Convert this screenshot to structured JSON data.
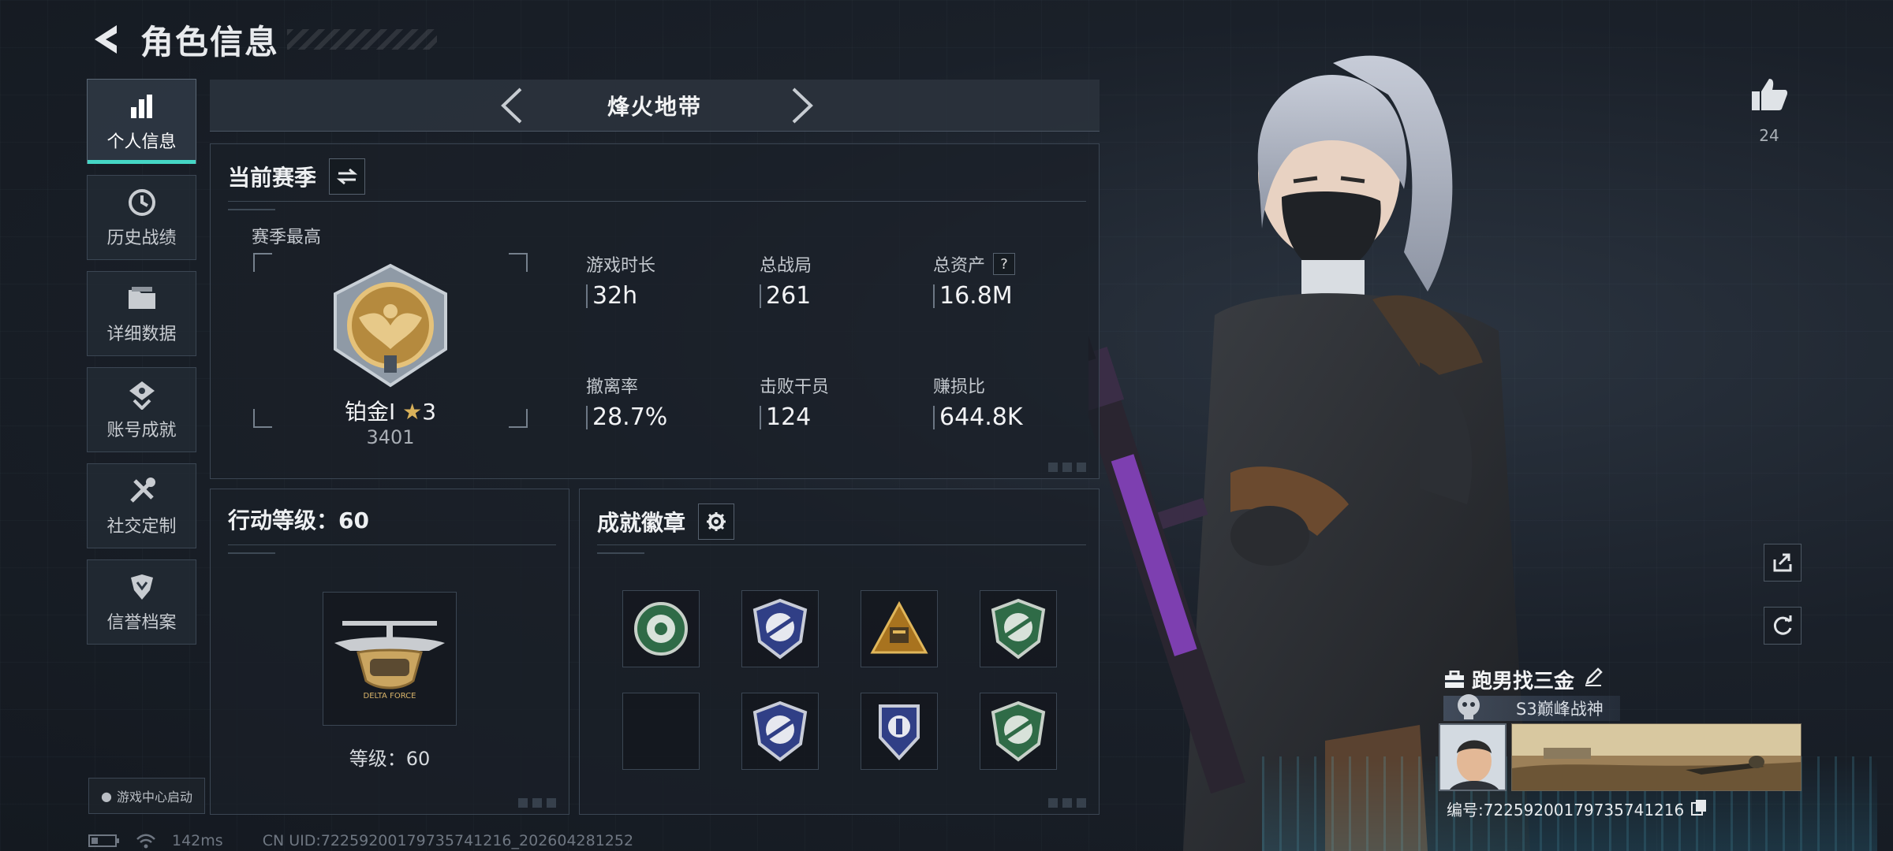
{
  "header": {
    "title": "角色信息"
  },
  "sidebar": {
    "items": [
      {
        "label": "个人信息",
        "icon": "bar-chart-icon",
        "active": true
      },
      {
        "label": "历史战绩",
        "icon": "clock-icon",
        "active": false
      },
      {
        "label": "详细数据",
        "icon": "folder-icon",
        "active": false
      },
      {
        "label": "账号成就",
        "icon": "achievement-icon",
        "active": false
      },
      {
        "label": "社交定制",
        "icon": "tools-icon",
        "active": false
      },
      {
        "label": "信誉档案",
        "icon": "shield-emblem-icon",
        "active": false
      }
    ],
    "launch_label": "游戏中心启动"
  },
  "mode": {
    "title": "烽火地带"
  },
  "season": {
    "title": "当前赛季",
    "best_label": "赛季最高",
    "rank_name": "铂金I",
    "rank_stars": "3",
    "rank_score": "3401",
    "stats": [
      {
        "label": "游戏时长",
        "value": "32h"
      },
      {
        "label": "总战局",
        "value": "261"
      },
      {
        "label": "总资产",
        "value": "16.8M",
        "help": "?"
      },
      {
        "label": "撤离率",
        "value": "28.7%"
      },
      {
        "label": "击败干员",
        "value": "124"
      },
      {
        "label": "赚损比",
        "value": "644.8K"
      }
    ]
  },
  "level": {
    "title": "行动等级：60",
    "caption": "等级：60",
    "badge_text": "DELTA FORCE"
  },
  "badges": {
    "title": "成就徽章",
    "slots": [
      {
        "icon": "green-flower-badge-icon",
        "color": "#3f8a5c"
      },
      {
        "icon": "blue-rifle-badge-icon",
        "color": "#3c4f9a"
      },
      {
        "icon": "gold-triangle-badge-icon",
        "color": "#b7852c"
      },
      {
        "icon": "green-rifle-badge-icon",
        "color": "#3f8a5c"
      },
      {
        "icon": "empty-slot",
        "color": ""
      },
      {
        "icon": "blue-rifle-badge-icon",
        "color": "#3c4f9a"
      },
      {
        "icon": "blue-shield-badge-icon",
        "color": "#3c4f9a"
      },
      {
        "icon": "green-rifle-badge-icon",
        "color": "#3f8a5c"
      }
    ]
  },
  "player": {
    "likes": "24",
    "name": "跑男找三金",
    "title": "S3巅峰战神",
    "id_line": "编号:7225920017973574121​6"
  },
  "status": {
    "ping": "142ms",
    "uid": "CN UID:7225920017973574121​6_202604281252"
  },
  "colors": {
    "accent": "#45d6c5",
    "panel_border": "#3b4653"
  }
}
